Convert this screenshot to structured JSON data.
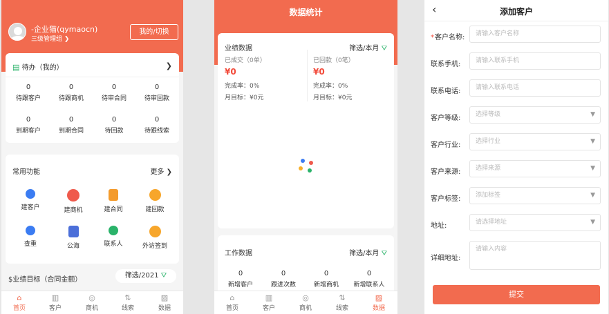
{
  "screen1": {
    "user_name": "-企业猫(qymaocn)",
    "user_role": "三级管理组 ❯",
    "switch_label": "我的/切换",
    "todo": {
      "title": "待办（我的）",
      "chevron": "❯",
      "items": [
        {
          "count": "0",
          "label": "待跟客户"
        },
        {
          "count": "0",
          "label": "待跟商机"
        },
        {
          "count": "0",
          "label": "待审合同"
        },
        {
          "count": "0",
          "label": "待审回款"
        },
        {
          "count": "0",
          "label": "到期客户"
        },
        {
          "count": "0",
          "label": "到期合同"
        },
        {
          "count": "0",
          "label": "待回款"
        },
        {
          "count": "0",
          "label": "待跟线索"
        }
      ]
    },
    "functions": {
      "title": "常用功能",
      "more": "更多 ❯",
      "items": [
        {
          "label": "建客户",
          "icon": "add-customer-icon"
        },
        {
          "label": "建商机",
          "icon": "add-opportunity-icon"
        },
        {
          "label": "建合同",
          "icon": "add-contract-icon"
        },
        {
          "label": "建回款",
          "icon": "add-payment-icon"
        },
        {
          "label": "查重",
          "icon": "check-duplicate-icon"
        },
        {
          "label": "公海",
          "icon": "public-pool-icon"
        },
        {
          "label": "联系人",
          "icon": "contact-icon"
        },
        {
          "label": "外访签到",
          "icon": "visit-checkin-icon"
        }
      ]
    },
    "goal": {
      "title": "$业绩目标（合同金额）",
      "filter": "筛选/2021"
    },
    "tabs": [
      {
        "label": "首页",
        "icon": "home-icon"
      },
      {
        "label": "客户",
        "icon": "customer-icon"
      },
      {
        "label": "商机",
        "icon": "opportunity-icon"
      },
      {
        "label": "线索",
        "icon": "lead-icon"
      },
      {
        "label": "数据",
        "icon": "data-icon"
      }
    ]
  },
  "screen2": {
    "title": "数据统计",
    "performance": {
      "title": "业绩数据",
      "filter": "筛选/本月",
      "left": {
        "a": "已成交（0单）",
        "m": "¥0",
        "r": "完成率：0%",
        "t": "月目标：¥0元"
      },
      "right": {
        "a": "已回款（0笔）",
        "m": "¥0",
        "r": "完成率：0%",
        "t": "月目标：¥0元"
      }
    },
    "work": {
      "title": "工作数据",
      "filter": "筛选/本月",
      "items": [
        {
          "count": "0",
          "label": "新增客户"
        },
        {
          "count": "0",
          "label": "跟进次数"
        },
        {
          "count": "0",
          "label": "新增商机"
        },
        {
          "count": "0",
          "label": "新增联系人"
        }
      ]
    },
    "tabs": [
      {
        "label": "首页"
      },
      {
        "label": "客户"
      },
      {
        "label": "商机"
      },
      {
        "label": "线索"
      },
      {
        "label": "数据"
      }
    ],
    "colors": {
      "dot1": "#3b7cf2",
      "dot2": "#ef5a4c",
      "dot3": "#f7b02b",
      "dot4": "#2ab36a"
    }
  },
  "screen3": {
    "title": "添加客户",
    "back": "‹",
    "fields": [
      {
        "label": "客户名称:",
        "placeholder": "请输入客户名称",
        "required": true
      },
      {
        "label": "联系手机:",
        "placeholder": "请输入联系手机"
      },
      {
        "label": "联系电话:",
        "placeholder": "请输入联系电话"
      },
      {
        "label": "客户等级:",
        "placeholder": "选择等级",
        "dropdown": true
      },
      {
        "label": "客户行业:",
        "placeholder": "选择行业",
        "dropdown": true
      },
      {
        "label": "客户来源:",
        "placeholder": "选择来源",
        "dropdown": true
      },
      {
        "label": "客户标签:",
        "placeholder": "添加标签",
        "dropdown": true
      },
      {
        "label": "地址:",
        "placeholder": "请选择地址",
        "dropdown": true
      },
      {
        "label": "详细地址:",
        "placeholder": "请输入内容"
      }
    ],
    "required_mark": "*",
    "dropdown_arrow": "▼",
    "submit": "提交"
  },
  "colors": {
    "brand": "#f26b4f",
    "money": "#f24a3a",
    "filter": "#2ab36a"
  }
}
